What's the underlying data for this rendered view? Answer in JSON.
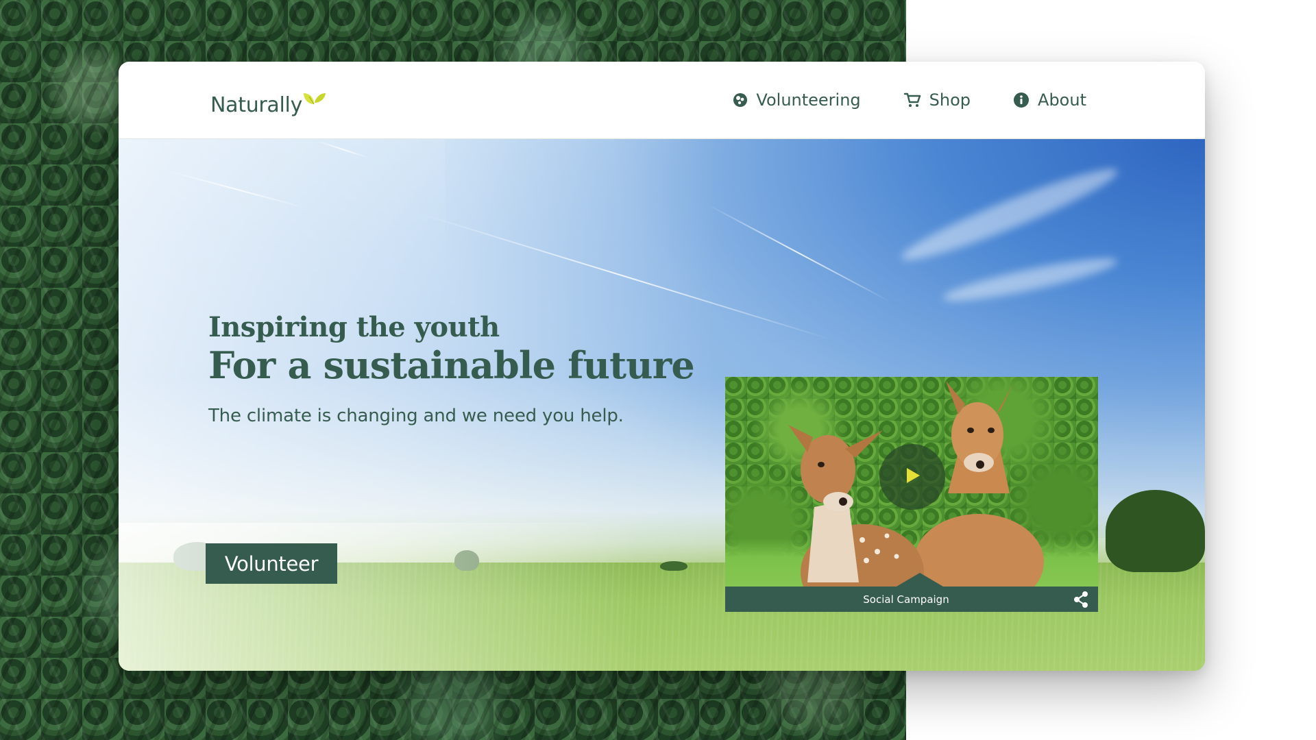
{
  "brand": {
    "name": "Naturally",
    "logo_icon": "leaf-icon",
    "primary_color": "#355c4e",
    "accent_color": "#d6e23a"
  },
  "nav": {
    "items": [
      {
        "label": "Volunteering",
        "icon": "globe-icon"
      },
      {
        "label": "Shop",
        "icon": "cart-icon"
      },
      {
        "label": "About",
        "icon": "info-icon"
      }
    ]
  },
  "hero": {
    "subtitle": "Inspiring the youth",
    "headline": "For a sustainable future",
    "tagline": "The climate is changing and we need you help.",
    "cta_label": "Volunteer"
  },
  "video": {
    "caption": "Social Campaign",
    "play_icon": "play-icon",
    "share_icon": "share-icon",
    "play_color": "#e5e035"
  }
}
